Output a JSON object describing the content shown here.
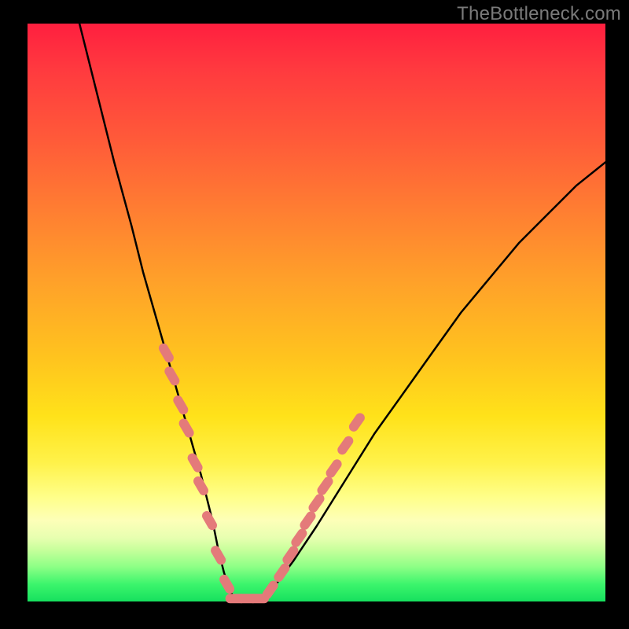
{
  "watermark": "TheBottleneck.com",
  "colors": {
    "page_bg": "#000000",
    "gradient_top": "#ff1f3f",
    "gradient_mid": "#ffe21a",
    "gradient_bottom": "#16e05e",
    "curve_stroke": "#000000",
    "marker_fill": "#e47a7a",
    "marker_stroke": "#c95b5b"
  },
  "chart_data": {
    "type": "line",
    "title": "",
    "xlabel": "",
    "ylabel": "",
    "xlim": [
      0,
      100
    ],
    "ylim": [
      0,
      100
    ],
    "grid": false,
    "series": [
      {
        "name": "bottleneck-curve",
        "x": [
          9,
          12,
          15,
          18,
          20,
          22,
          24,
          26,
          28,
          30,
          32,
          33,
          34,
          35,
          36,
          38,
          40,
          43,
          46,
          50,
          55,
          60,
          65,
          70,
          75,
          80,
          85,
          90,
          95,
          100
        ],
        "y": [
          100,
          88,
          76,
          65,
          57,
          50,
          43,
          36,
          29,
          22,
          14,
          9,
          5,
          2,
          0,
          0,
          0,
          3,
          7,
          13,
          21,
          29,
          36,
          43,
          50,
          56,
          62,
          67,
          72,
          76
        ]
      }
    ],
    "markers": {
      "name": "highlighted-points",
      "comment": "pink lozenge markers clustered near curve bottom on both arms",
      "points": [
        {
          "x": 24,
          "y": 43
        },
        {
          "x": 25,
          "y": 39
        },
        {
          "x": 26.5,
          "y": 34
        },
        {
          "x": 27.5,
          "y": 30
        },
        {
          "x": 29,
          "y": 24
        },
        {
          "x": 30,
          "y": 20
        },
        {
          "x": 31.5,
          "y": 14
        },
        {
          "x": 33,
          "y": 8
        },
        {
          "x": 34.5,
          "y": 3
        },
        {
          "x": 36,
          "y": 0.5
        },
        {
          "x": 38,
          "y": 0.5
        },
        {
          "x": 40,
          "y": 0.5
        },
        {
          "x": 42,
          "y": 2
        },
        {
          "x": 44,
          "y": 5
        },
        {
          "x": 45.5,
          "y": 8
        },
        {
          "x": 47,
          "y": 11
        },
        {
          "x": 48.5,
          "y": 14
        },
        {
          "x": 50,
          "y": 17
        },
        {
          "x": 51.5,
          "y": 20
        },
        {
          "x": 53,
          "y": 23
        },
        {
          "x": 55,
          "y": 27
        },
        {
          "x": 57,
          "y": 31
        }
      ]
    }
  }
}
